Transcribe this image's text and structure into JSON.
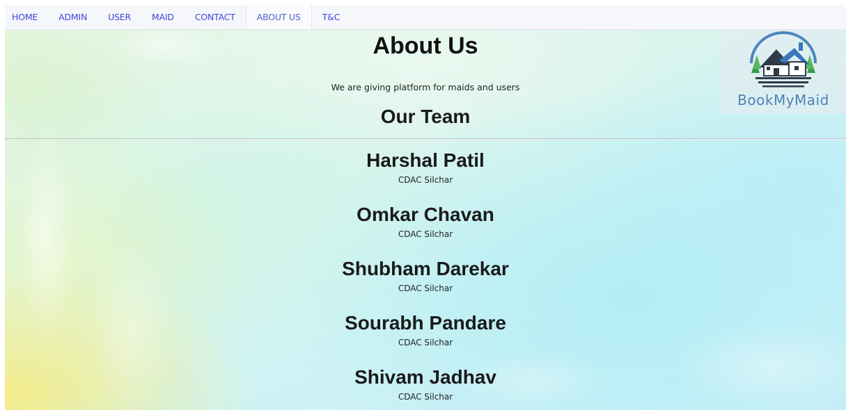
{
  "navbar": {
    "items": [
      {
        "label": "HOME",
        "active": false
      },
      {
        "label": "ADMIN",
        "active": false
      },
      {
        "label": "USER",
        "active": false
      },
      {
        "label": "MAID",
        "active": false
      },
      {
        "label": "CONTACT",
        "active": false
      },
      {
        "label": "ABOUT US",
        "active": true
      },
      {
        "label": "T&C",
        "active": false
      }
    ]
  },
  "logo": {
    "text": "BookMyMaid",
    "icon": "house-logo-icon"
  },
  "main": {
    "title": "About Us",
    "tagline": "We are giving platform for maids and users",
    "team_heading": "Our Team",
    "team": [
      {
        "name": "Harshal Patil",
        "org": "CDAC Silchar"
      },
      {
        "name": "Omkar Chavan",
        "org": "CDAC Silchar"
      },
      {
        "name": "Shubham Darekar",
        "org": "CDAC Silchar"
      },
      {
        "name": "Sourabh Pandare",
        "org": "CDAC Silchar"
      },
      {
        "name": "Shivam Jadhav",
        "org": "CDAC Silchar"
      }
    ]
  },
  "colors": {
    "nav_link": "#3d45d6",
    "logo_text": "#4a83b8",
    "logo_roof": "#2f6fb0",
    "logo_trees": "#4caf50"
  }
}
